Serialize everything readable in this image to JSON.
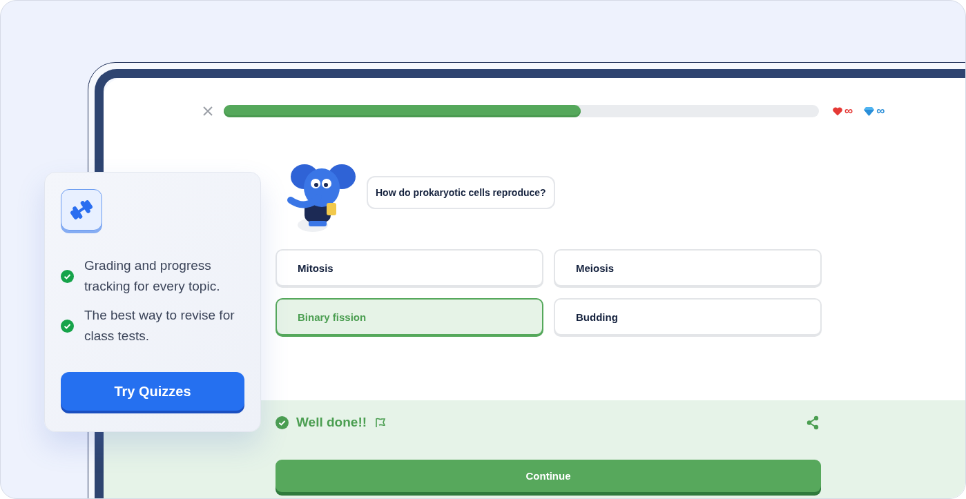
{
  "quiz": {
    "progress": {
      "level": 0.6
    },
    "stats": [
      {
        "kind": "lives",
        "value": "∞"
      },
      {
        "kind": "gems",
        "value": "∞"
      }
    ],
    "question": "How do prokaryotic cells reproduce?",
    "options": [
      {
        "label": "Mitosis",
        "selected": false
      },
      {
        "label": "Meiosis",
        "selected": false
      },
      {
        "label": "Binary fission",
        "selected": true
      },
      {
        "label": "Budding",
        "selected": false
      }
    ],
    "feedback": {
      "message": "Well done!!"
    },
    "continue_button": "Continue"
  },
  "promo_card": {
    "features": [
      "Grading and progress tracking for every topic.",
      "The best way to revise for class tests."
    ],
    "button": "Try Quizzes"
  }
}
